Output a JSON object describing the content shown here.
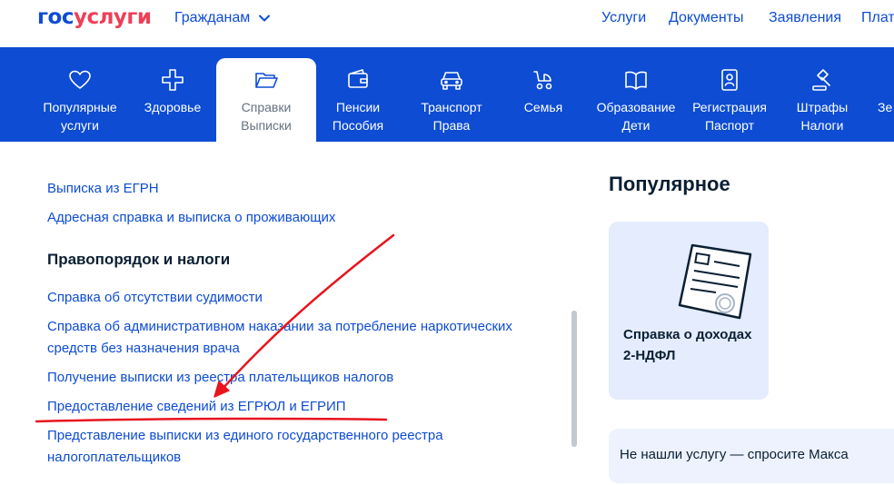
{
  "header": {
    "logo_part1": "гос",
    "logo_part2": "услуги",
    "audience_menu": "Гражданам",
    "nav": [
      "Услуги",
      "Документы",
      "Заявления",
      "Плате"
    ]
  },
  "categories": [
    {
      "line1": "Популярные",
      "line2": "услуги",
      "icon": "heart-icon"
    },
    {
      "line1": "Здоровье",
      "line2": "",
      "icon": "health-cross-icon"
    },
    {
      "line1": "Справки",
      "line2": "Выписки",
      "icon": "folder-icon",
      "active": true
    },
    {
      "line1": "Пенсии",
      "line2": "Пособия",
      "icon": "wallet-icon"
    },
    {
      "line1": "Транспорт",
      "line2": "Права",
      "icon": "car-icon"
    },
    {
      "line1": "Семья",
      "line2": "",
      "icon": "stroller-icon"
    },
    {
      "line1": "Образование",
      "line2": "Дети",
      "icon": "book-icon"
    },
    {
      "line1": "Регистрация",
      "line2": "Паспорт",
      "icon": "passport-icon"
    },
    {
      "line1": "Штрафы",
      "line2": "Налоги",
      "icon": "gavel-icon"
    },
    {
      "line1": "Зе",
      "line2": "",
      "icon": ""
    }
  ],
  "links_top": [
    "Выписка из ЕГРН",
    "Адресная справка и выписка о проживающих"
  ],
  "section_title": "Правопорядок и налоги",
  "links_section": [
    "Справка об отсутствии судимости",
    "Справка об административном наказании за потребление наркотических",
    "средств без назначения врача",
    "Получение выписки из реестра плательщиков налогов",
    "Предоставление сведений из ЕГРЮЛ и ЕГРИП",
    "Представление выписки из единого государственного реестра",
    "налогоплательщиков"
  ],
  "popular": {
    "title": "Популярное",
    "card_line1": "Справка о доходах",
    "card_line2": "2-НДФЛ",
    "ask": "Не нашли услугу — спросите Макса"
  },
  "colors": {
    "brand_blue": "#0d4cd3",
    "brand_red": "#ee3f58",
    "annotation_red": "#e8141e"
  }
}
